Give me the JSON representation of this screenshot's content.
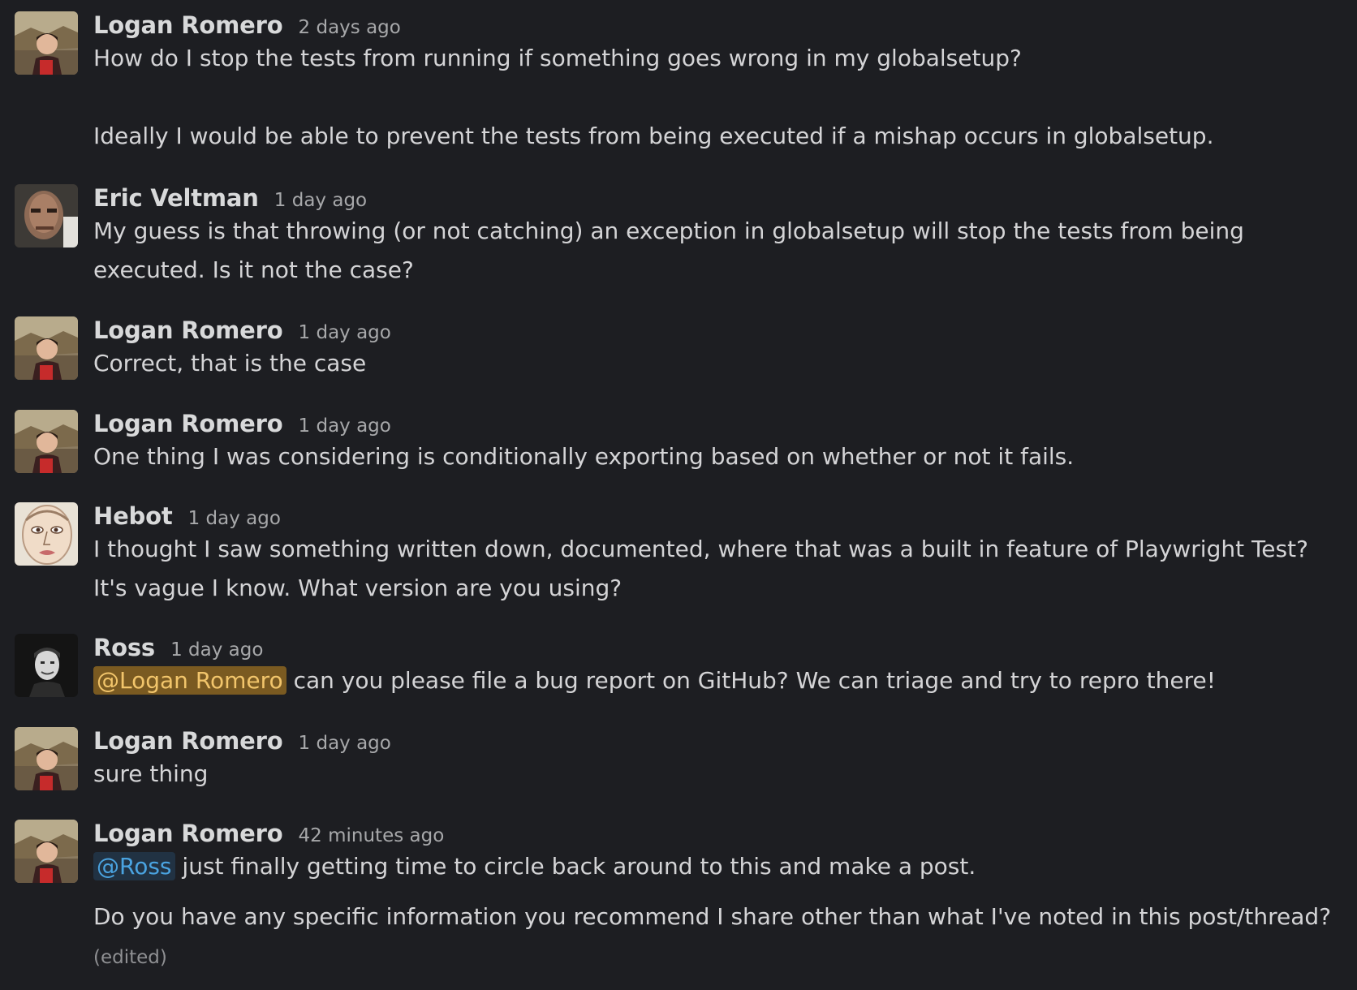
{
  "colors": {
    "background": "#1d1e22",
    "author_text": "#d8d9da",
    "timestamp_text": "#a7a8aa",
    "mention_self_bg": "#7a5a21",
    "mention_self_text": "#f2c56b",
    "mention_other_bg": "#213243",
    "mention_other_text": "#4aa3e0"
  },
  "messages": [
    {
      "author": "Logan Romero",
      "time": "2 days ago",
      "avatar": "logan-avatar",
      "lines": [
        "How do I stop the tests from running if something goes wrong in my globalsetup?",
        "Ideally I would be able to prevent the tests from being executed if a mishap occurs in globalsetup."
      ]
    },
    {
      "author": "Eric Veltman",
      "time": "1 day ago",
      "avatar": "eric-avatar",
      "lines": [
        "My guess is that throwing (or not catching) an exception in globalsetup will stop the tests from being executed. Is it not the case?"
      ]
    },
    {
      "author": "Logan Romero",
      "time": "1 day ago",
      "avatar": "logan-avatar",
      "lines": [
        "Correct, that is the case"
      ]
    },
    {
      "author": "Logan Romero",
      "time": "1 day ago",
      "avatar": "logan-avatar",
      "lines": [
        "One thing I was considering is conditionally exporting based on whether or not it fails."
      ]
    },
    {
      "author": "Hebot",
      "time": "1 day ago",
      "avatar": "hebot-avatar",
      "lines": [
        "I thought I saw something written down, documented, where that was a built in feature of Playwright Test? It's vague I know. What version are you using?"
      ]
    },
    {
      "author": "Ross",
      "time": "1 day ago",
      "avatar": "ross-avatar",
      "mention": "@Logan Romero",
      "lines": [
        " can you please file a bug report on GitHub? We can triage and try to repro there!"
      ]
    },
    {
      "author": "Logan Romero",
      "time": "1 day ago",
      "avatar": "logan-avatar",
      "lines": [
        "sure thing"
      ]
    },
    {
      "author": "Logan Romero",
      "time": "42 minutes ago",
      "avatar": "logan-avatar",
      "mention": "@Ross",
      "lines": [
        " just finally getting time to circle back around to this and make a post.",
        "Do you have any specific information you recommend I share other than what I've noted in this post/thread? "
      ],
      "edited": "(edited)"
    }
  ]
}
